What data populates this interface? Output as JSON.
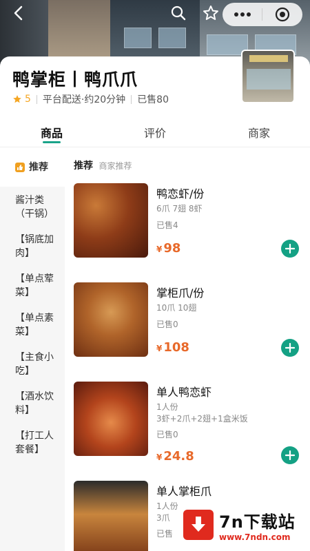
{
  "store": {
    "name": "鸭掌柜丨鸭爪爪",
    "rating": "5",
    "delivery": "平台配送·约20分钟",
    "sold": "已售80"
  },
  "tabs": [
    {
      "label": "商品"
    },
    {
      "label": "评价"
    },
    {
      "label": "商家"
    }
  ],
  "sidebar": {
    "items": [
      {
        "label": "推荐"
      },
      {
        "label": "酱汁类（干锅）"
      },
      {
        "label": "【锅底加肉】"
      },
      {
        "label": "【单点荤菜】"
      },
      {
        "label": "【单点素菜】"
      },
      {
        "label": "【主食小吃】"
      },
      {
        "label": "【酒水饮料】"
      },
      {
        "label": "【打工人套餐】"
      }
    ]
  },
  "section": {
    "title": "推荐",
    "subtitle": "商家推荐"
  },
  "currency": "¥",
  "dishes": [
    {
      "name": "鸭恋虾/份",
      "desc": "6爪 7翅 8虾",
      "sold": "已售4",
      "price": "98"
    },
    {
      "name": "掌柜爪/份",
      "desc": "10爪 10翅",
      "sold": "已售0",
      "price": "108"
    },
    {
      "name": "单人鸭恋虾",
      "desc": "1人份",
      "desc2": "3虾+2爪+2翅+1盒米饭",
      "sold": "已售0",
      "price": "24.8"
    },
    {
      "name": "单人掌柜爪",
      "desc": "1人份",
      "desc2": "3爪",
      "sold": "已售"
    }
  ],
  "watermark": {
    "title": "7n下载站",
    "url": "www.7ndn.com"
  },
  "colors": {
    "accent": "#14a184",
    "price": "#e8692a",
    "star": "#f5a623"
  }
}
